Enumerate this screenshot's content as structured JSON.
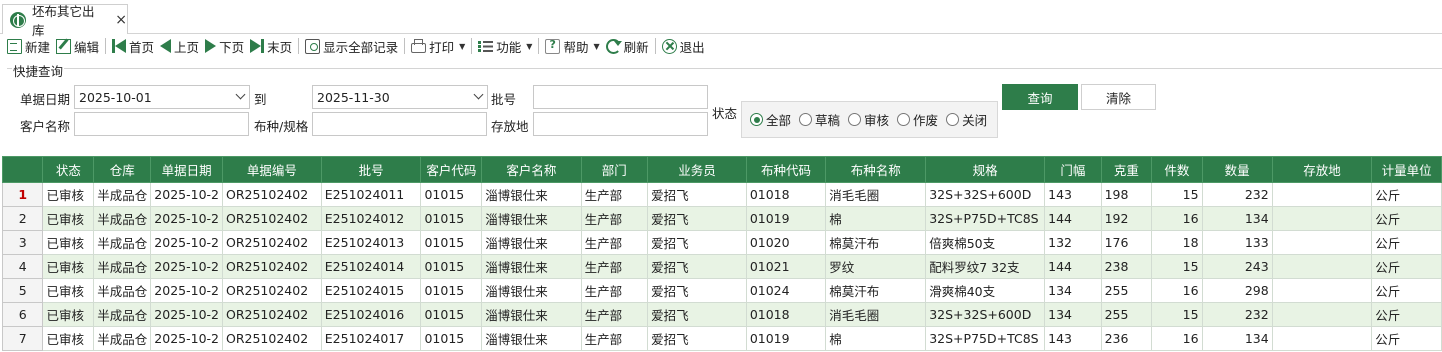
{
  "tab": {
    "title": "坯布其它出库",
    "close": "×"
  },
  "toolbar": {
    "new": "新建",
    "edit": "编辑",
    "first": "首页",
    "prev": "上页",
    "next": "下页",
    "last": "末页",
    "show_all": "显示全部记录",
    "print": "打印",
    "function": "功能",
    "help": "帮助",
    "refresh": "刷新",
    "exit": "退出"
  },
  "query": {
    "group_title": "快捷查询",
    "date_label": "单据日期",
    "date_from": "2025-10-01",
    "to_label": "到",
    "date_to": "2025-11-30",
    "batch_label": "批号",
    "batch_value": "",
    "customer_label": "客户名称",
    "customer_value": "",
    "fabric_label": "布种/规格",
    "fabric_value": "",
    "location_label": "存放地",
    "location_value": "",
    "status_label": "状态",
    "status_options": [
      "全部",
      "草稿",
      "审核",
      "作废",
      "关闭"
    ],
    "status_selected": "全部",
    "query_button": "查询",
    "clear_button": "清除"
  },
  "grid": {
    "columns": [
      "",
      "状态",
      "仓库",
      "单据日期",
      "单据编号",
      "批号",
      "客户代码",
      "客户名称",
      "部门",
      "业务员",
      "布种代码",
      "布种名称",
      "规格",
      "门幅",
      "克重",
      "件数",
      "数量",
      "存放地",
      "计量单位"
    ],
    "rows": [
      [
        "1",
        "已审核",
        "半成品仓",
        "2025-10-2",
        "OR25102402",
        "E251024011",
        "01015",
        "淄博银仕来",
        "生产部",
        "爱招飞",
        "01018",
        "消毛毛圈",
        "32S+32S+600D",
        "143",
        "198",
        "15",
        "232",
        "",
        "公斤"
      ],
      [
        "2",
        "已审核",
        "半成品仓",
        "2025-10-2",
        "OR25102402",
        "E251024012",
        "01015",
        "淄博银仕来",
        "生产部",
        "爱招飞",
        "01019",
        "棉",
        "32S+P75D+TC8S",
        "144",
        "192",
        "16",
        "134",
        "",
        "公斤"
      ],
      [
        "3",
        "已审核",
        "半成品仓",
        "2025-10-2",
        "OR25102402",
        "E251024013",
        "01015",
        "淄博银仕来",
        "生产部",
        "爱招飞",
        "01020",
        "棉莫汗布",
        "倍爽棉50支",
        "132",
        "176",
        "18",
        "133",
        "",
        "公斤"
      ],
      [
        "4",
        "已审核",
        "半成品仓",
        "2025-10-2",
        "OR25102402",
        "E251024014",
        "01015",
        "淄博银仕来",
        "生产部",
        "爱招飞",
        "01021",
        "罗纹",
        "配料罗纹7 32支",
        "144",
        "238",
        "15",
        "243",
        "",
        "公斤"
      ],
      [
        "5",
        "已审核",
        "半成品仓",
        "2025-10-2",
        "OR25102402",
        "E251024015",
        "01015",
        "淄博银仕来",
        "生产部",
        "爱招飞",
        "01024",
        "棉莫汗布",
        "滑爽棉40支",
        "134",
        "255",
        "16",
        "298",
        "",
        "公斤"
      ],
      [
        "6",
        "已审核",
        "半成品仓",
        "2025-10-2",
        "OR25102402",
        "E251024016",
        "01015",
        "淄博银仕来",
        "生产部",
        "爱招飞",
        "01018",
        "消毛毛圈",
        "32S+32S+600D",
        "134",
        "255",
        "15",
        "232",
        "",
        "公斤"
      ],
      [
        "7",
        "已审核",
        "半成品仓",
        "2025-10-2",
        "OR25102402",
        "E251024017",
        "01015",
        "淄博银仕来",
        "生产部",
        "爱招飞",
        "01019",
        "棉",
        "32S+P75D+TC8S",
        "143",
        "236",
        "16",
        "134",
        "",
        "公斤"
      ]
    ],
    "current_row": "1",
    "header_color": "#2e7d4a",
    "stripe_color": "#e8f3e4"
  }
}
